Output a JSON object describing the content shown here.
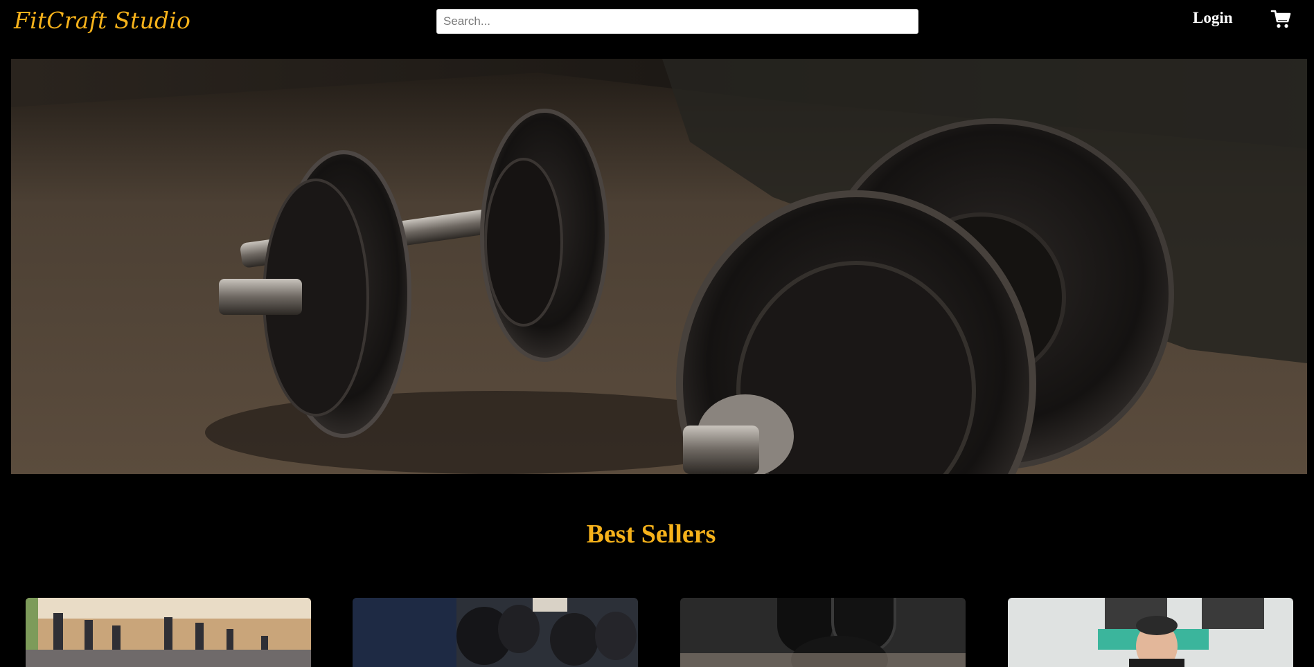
{
  "header": {
    "brand": "FitCraft Studio",
    "search_placeholder": "Search...",
    "login_label": "Login",
    "cart_icon": "shopping-cart-icon"
  },
  "hero": {
    "image": "dumbbells-on-floor-photo"
  },
  "best_sellers": {
    "title": "Best Sellers",
    "items": [
      {
        "image": "treadmills-in-gym-photo"
      },
      {
        "image": "dumbbell-rack-photo"
      },
      {
        "image": "kettlebell-photo"
      },
      {
        "image": "trainer-portrait-photo"
      }
    ]
  },
  "colors": {
    "background": "#000000",
    "accent": "#f6b21b",
    "text": "#ffffff"
  }
}
